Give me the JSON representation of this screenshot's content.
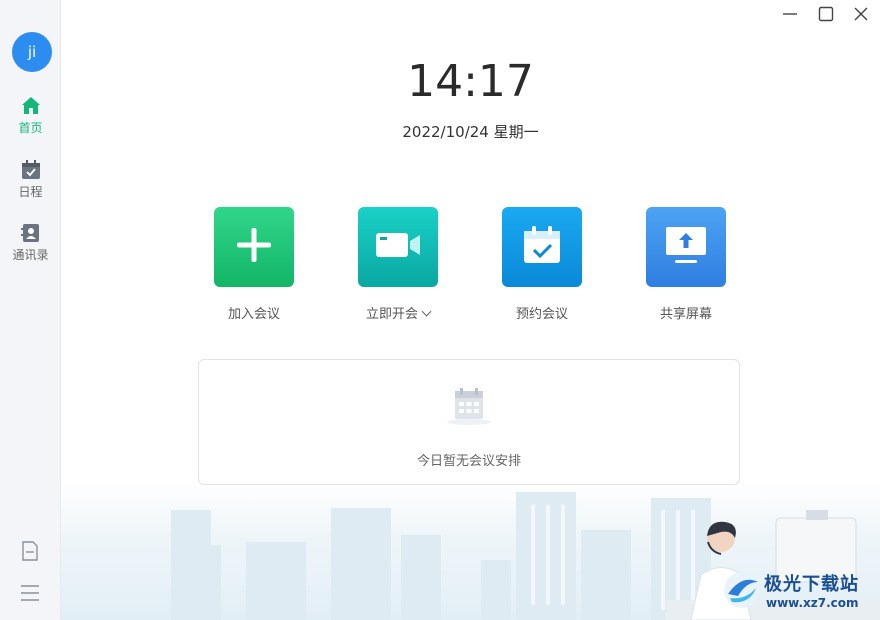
{
  "sidebar": {
    "avatar_text": "ji",
    "items": [
      {
        "label": "首页",
        "icon": "home-icon",
        "active": true
      },
      {
        "label": "日程",
        "icon": "calendar-icon",
        "active": false
      },
      {
        "label": "通讯录",
        "icon": "contacts-icon",
        "active": false
      }
    ],
    "bottom_icons": [
      "document-icon",
      "menu-icon"
    ]
  },
  "window_controls": [
    "minimize-icon",
    "maximize-icon",
    "close-icon"
  ],
  "clock": {
    "time": "14:17",
    "date": "2022/10/24 星期一"
  },
  "actions": [
    {
      "label": "加入会议",
      "icon": "plus-icon",
      "color": "#13b566"
    },
    {
      "label": "立即开会",
      "icon": "video-camera-icon",
      "color": "#0aa7a2",
      "has_dropdown": true
    },
    {
      "label": "预约会议",
      "icon": "calendar-check-icon",
      "color": "#0a89d8"
    },
    {
      "label": "共享屏幕",
      "icon": "screen-share-icon",
      "color": "#2f7ee0"
    }
  ],
  "schedule_card": {
    "empty_text": "今日暂无会议安排"
  },
  "watermark": {
    "name": "极光下载站",
    "url": "www.xz7.com"
  },
  "colors": {
    "accent": "#14b77a",
    "avatar": "#2d8cf0"
  }
}
